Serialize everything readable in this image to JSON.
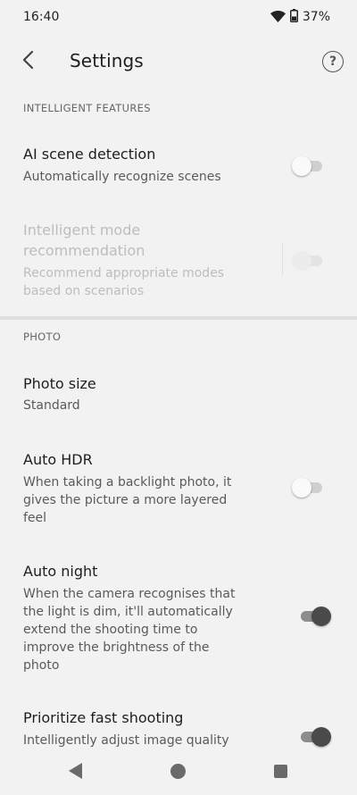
{
  "status_bar": {
    "time": "16:40",
    "battery": "37%"
  },
  "header": {
    "title": "Settings"
  },
  "sections": {
    "intelligent": "INTELLIGENT FEATURES",
    "photo": "PHOTO"
  },
  "settings": {
    "ai_scene": {
      "title": "AI scene detection",
      "subtitle": "Automatically recognize scenes",
      "enabled": false
    },
    "intelligent_mode": {
      "title_line1": "Intelligent mode",
      "title_line2": "recommendation",
      "subtitle_line1": "Recommend appropriate modes",
      "subtitle_line2": "based on scenarios",
      "enabled": false,
      "disabled": true
    },
    "photo_size": {
      "title": "Photo size",
      "value": "Standard"
    },
    "auto_hdr": {
      "title": "Auto HDR",
      "subtitle_line1": "When taking a backlight photo, it",
      "subtitle_line2": "gives the picture a more layered",
      "subtitle_line3": "feel",
      "enabled": false
    },
    "auto_night": {
      "title": "Auto night",
      "subtitle_line1": "When the camera recognises that",
      "subtitle_line2": "the light is dim, it'll automatically",
      "subtitle_line3": "extend the shooting time to",
      "subtitle_line4": "improve the brightness of the",
      "subtitle_line5": "photo",
      "enabled": true
    },
    "fast_shooting": {
      "title": "Prioritize fast shooting",
      "subtitle": "Intelligently adjust image quality",
      "enabled": true
    }
  },
  "icons": {
    "back": "chevron-left-icon",
    "help": "help-circle-icon",
    "wifi": "wifi-icon",
    "battery": "battery-icon"
  }
}
